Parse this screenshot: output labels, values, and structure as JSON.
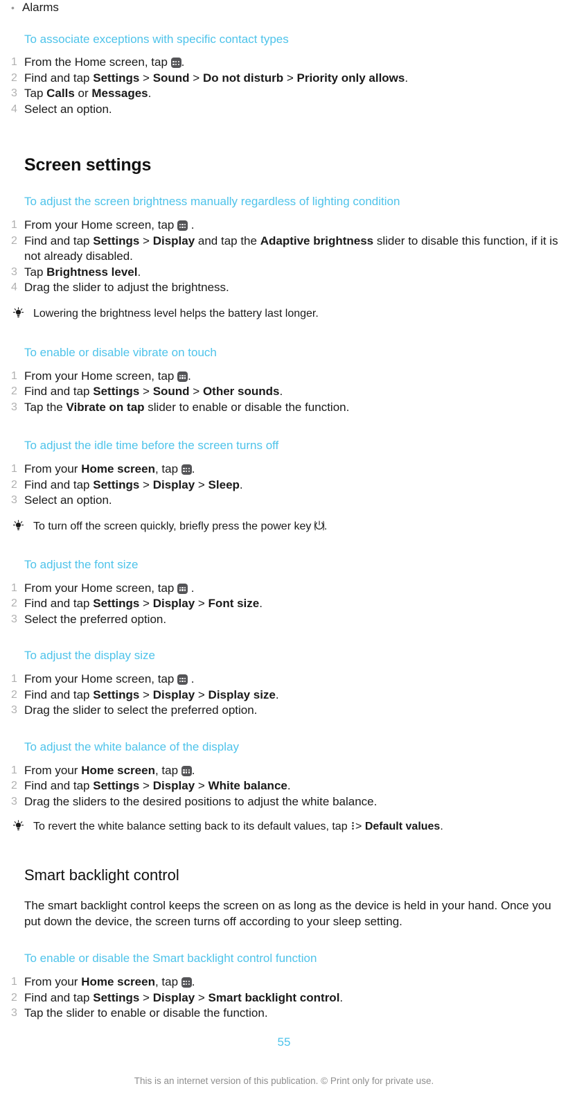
{
  "document": {
    "page_number": "55",
    "footer_note": "This is an internet version of this publication. © Print only for private use.",
    "accent_color": "#4ec3ea",
    "number_color": "#b0b0b0",
    "text_color": "#1a1a1a"
  },
  "bullet_item": {
    "bullet": "•",
    "label": "Alarms"
  },
  "procedures": [
    {
      "title": "To associate exceptions with specific contact types",
      "steps": [
        {
          "num": "1",
          "pre": "From the Home screen, tap ",
          "icon": "app-drawer-icon",
          "post": "."
        },
        {
          "num": "2",
          "pre": "Find and tap ",
          "bold_path": [
            "Settings",
            "Sound",
            "Do not disturb",
            "Priority only allows"
          ],
          "post": "."
        },
        {
          "num": "3",
          "pre": "Tap ",
          "bold_a": "Calls",
          "mid": " or ",
          "bold_b": "Messages",
          "post": "."
        },
        {
          "num": "4",
          "pre": "Select an option.",
          "post": ""
        }
      ]
    }
  ],
  "screen_settings": {
    "heading": "Screen settings",
    "proc_brightness": {
      "title": "To adjust the screen brightness manually regardless of lighting condition",
      "steps": [
        {
          "num": "1",
          "pre": "From your Home screen, tap ",
          "icon": "app-drawer-icon",
          "post": " ."
        },
        {
          "num": "2",
          "pre": "Find and tap ",
          "b1": "Settings",
          "gt": " > ",
          "b2": "Display",
          "mid": " and tap the ",
          "b3": "Adaptive brightness",
          "post": " slider to disable this function, if it is not already disabled."
        },
        {
          "num": "3",
          "pre": "Tap ",
          "b1": "Brightness level",
          "post": "."
        },
        {
          "num": "4",
          "pre": "Drag the slider to adjust the brightness.",
          "post": ""
        }
      ],
      "tip": "Lowering the brightness level helps the battery last longer."
    },
    "proc_vibrate": {
      "title": "To enable or disable vibrate on touch",
      "steps": [
        {
          "num": "1",
          "pre": "From your Home screen, tap ",
          "icon": "app-drawer-icon",
          "post": "."
        },
        {
          "num": "2",
          "pre": "Find and tap ",
          "b1": "Settings",
          "b2": "Sound",
          "b3": "Other sounds",
          "post": "."
        },
        {
          "num": "3",
          "pre": "Tap the ",
          "b1": "Vibrate on tap",
          "post": " slider to enable or disable the function."
        }
      ]
    },
    "proc_idle": {
      "title": "To adjust the idle time before the screen turns off",
      "steps": [
        {
          "num": "1",
          "pre": "From your ",
          "b1": "Home screen",
          "mid": ", tap ",
          "icon": "app-drawer-icon",
          "post": "."
        },
        {
          "num": "2",
          "pre": "Find and tap ",
          "b1": "Settings",
          "b2": "Display",
          "b3": "Sleep",
          "post": "."
        },
        {
          "num": "3",
          "pre": "Select an option.",
          "post": ""
        }
      ],
      "tip_pre": "To turn off the screen quickly, briefly press the power key ",
      "tip_icon": "power-key-icon",
      "tip_post": "."
    },
    "proc_font": {
      "title": "To adjust the font size",
      "steps": [
        {
          "num": "1",
          "pre": "From your Home screen, tap ",
          "icon": "app-drawer-icon",
          "post": " ."
        },
        {
          "num": "2",
          "pre": "Find and tap ",
          "b1": "Settings",
          "b2": "Display",
          "b3": "Font size",
          "post": "."
        },
        {
          "num": "3",
          "pre": "Select the preferred option.",
          "post": ""
        }
      ]
    },
    "proc_display_size": {
      "title": "To adjust the display size",
      "steps": [
        {
          "num": "1",
          "pre": "From your Home screen, tap ",
          "icon": "app-drawer-icon",
          "post": " ."
        },
        {
          "num": "2",
          "pre": "Find and tap ",
          "b1": "Settings",
          "b2": "Display",
          "b3": "Display size",
          "post": "."
        },
        {
          "num": "3",
          "pre": "Drag the slider to select the preferred option.",
          "post": ""
        }
      ]
    },
    "proc_white_balance": {
      "title": "To adjust the white balance of the display",
      "steps": [
        {
          "num": "1",
          "pre": "From your ",
          "b1": "Home screen",
          "mid": ", tap ",
          "icon": "app-drawer-icon",
          "post": "."
        },
        {
          "num": "2",
          "pre": "Find and tap ",
          "b1": "Settings",
          "b2": "Display",
          "b3": "White balance",
          "post": "."
        },
        {
          "num": "3",
          "pre": "Drag the sliders to the desired positions to adjust the white balance.",
          "post": ""
        }
      ],
      "tip_pre": "To revert the white balance setting back to its default values, tap ",
      "tip_icon": "overflow-menu-icon",
      "tip_mid": "> ",
      "tip_bold": "Default values",
      "tip_post": "."
    }
  },
  "smart_backlight": {
    "heading": "Smart backlight control",
    "paragraph": "The smart backlight control keeps the screen on as long as the device is held in your hand. Once you put down the device, the screen turns off according to your sleep setting.",
    "proc": {
      "title": "To enable or disable the Smart backlight control function",
      "steps": [
        {
          "num": "1",
          "pre": "From your ",
          "b1": "Home screen",
          "mid": ", tap ",
          "icon": "app-drawer-icon",
          "post": "."
        },
        {
          "num": "2",
          "pre": "Find and tap ",
          "b1": "Settings",
          "b2": "Display",
          "b3": "Smart backlight control",
          "post": "."
        },
        {
          "num": "3",
          "pre": "Tap the slider to enable or disable the function.",
          "post": ""
        }
      ]
    }
  },
  "separators": {
    "gt": " > "
  }
}
